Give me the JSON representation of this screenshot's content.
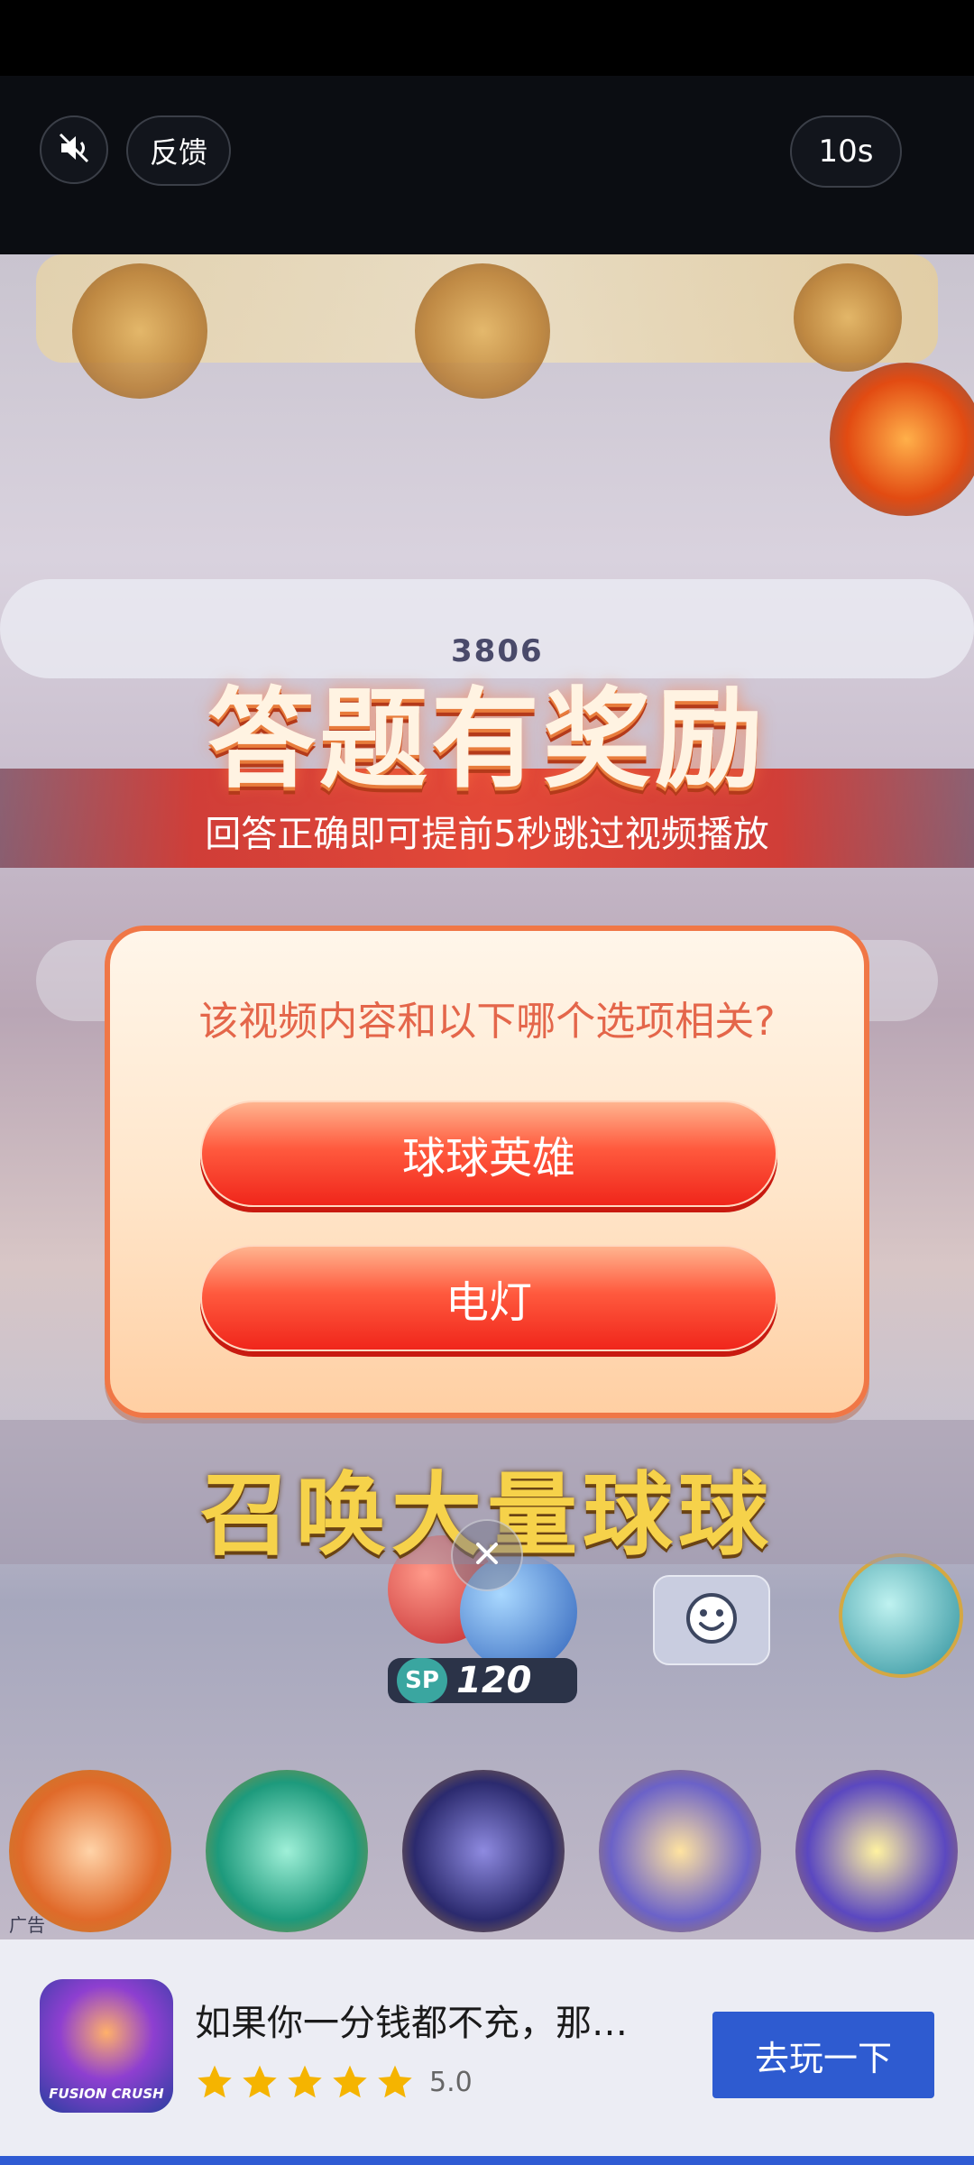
{
  "topbar": {
    "mute_icon": "muted-speaker-icon",
    "feedback_label": "反馈",
    "countdown": "10s"
  },
  "video": {
    "score_text": "3806",
    "headline": "答题有奖励",
    "subline": "回答正确即可提前5秒跳过视频播放",
    "promo_text": "召唤大量球球",
    "sp_value": "120",
    "sp_badge": "SP",
    "ad_label": "广告",
    "close_icon": "close-icon",
    "emoji_icon": "smiley-icon"
  },
  "quiz": {
    "question": "该视频内容和以下哪个选项相关?",
    "answers": [
      "球球英雄",
      "电灯"
    ]
  },
  "ad_card": {
    "icon_text": "FUSION CRUSH",
    "title": "如果你一分钱都不充，那…",
    "stars": 5,
    "rating": "5.0",
    "cta_label": "去玩一下"
  },
  "colors": {
    "cta": "#2e5bd0",
    "answer_red": "#f0261b",
    "question_text": "#e4664a",
    "star": "#f5b400"
  }
}
